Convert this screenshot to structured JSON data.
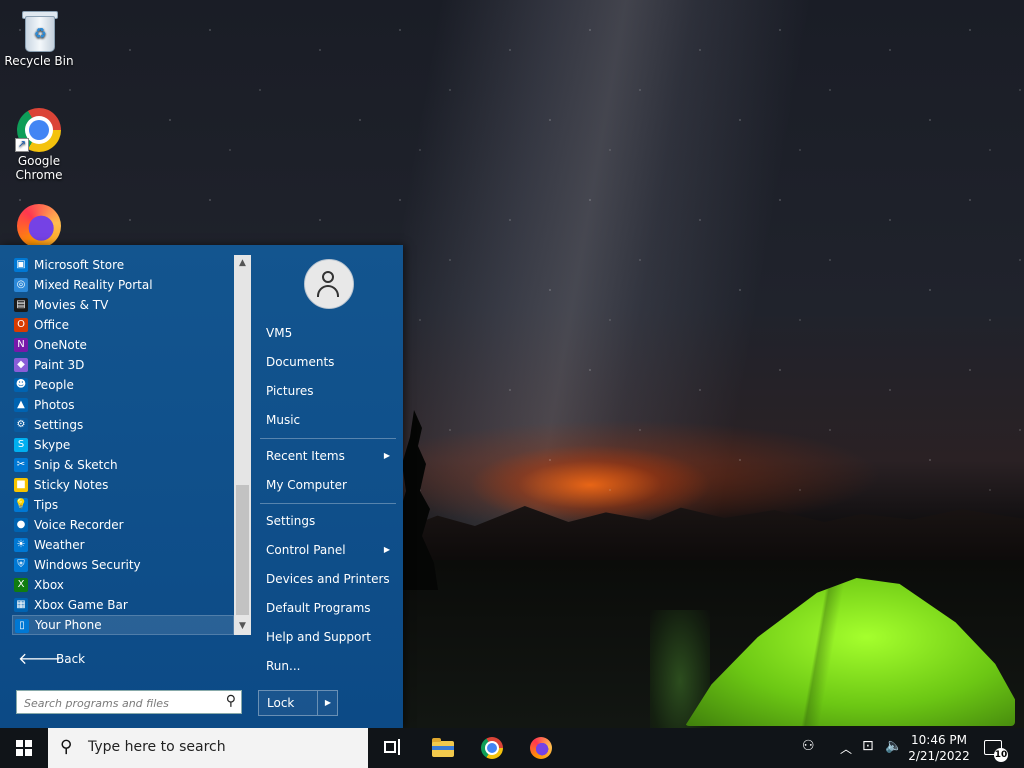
{
  "desktop": {
    "icons": [
      {
        "label": "Recycle Bin",
        "icon": "recycle-bin-icon"
      },
      {
        "label_line1": "Google",
        "label_line2": "Chrome",
        "icon": "chrome-icon"
      },
      {
        "label": "Firefox",
        "icon": "firefox-icon"
      }
    ]
  },
  "start_menu": {
    "programs": [
      {
        "label": "Microsoft Store",
        "icon": "store-icon",
        "color": "#0078d4",
        "glyph": "▣"
      },
      {
        "label": "Mixed Reality Portal",
        "icon": "mixed-reality-icon",
        "color": "#2b88d8",
        "glyph": "◎"
      },
      {
        "label": "Movies & TV",
        "icon": "movies-icon",
        "color": "#1a1a1a",
        "glyph": "▤"
      },
      {
        "label": "Office",
        "icon": "office-icon",
        "color": "#d83b01",
        "glyph": "O"
      },
      {
        "label": "OneNote",
        "icon": "onenote-icon",
        "color": "#7719aa",
        "glyph": "N"
      },
      {
        "label": "Paint 3D",
        "icon": "paint3d-icon",
        "color": "#8a5dd8",
        "glyph": "◆"
      },
      {
        "label": "People",
        "icon": "people-icon",
        "color": "#0063b1",
        "glyph": "☻"
      },
      {
        "label": "Photos",
        "icon": "photos-icon",
        "color": "#0063b1",
        "glyph": "▲"
      },
      {
        "label": "Settings",
        "icon": "settings-gear-icon",
        "color": "#0a5a9e",
        "glyph": "⚙"
      },
      {
        "label": "Skype",
        "icon": "skype-icon",
        "color": "#00aff0",
        "glyph": "S"
      },
      {
        "label": "Snip & Sketch",
        "icon": "snip-sketch-icon",
        "color": "#0078d4",
        "glyph": "✂"
      },
      {
        "label": "Sticky Notes",
        "icon": "sticky-notes-icon",
        "color": "#f7c300",
        "glyph": "■"
      },
      {
        "label": "Tips",
        "icon": "tips-icon",
        "color": "#0078d4",
        "glyph": "💡"
      },
      {
        "label": "Voice Recorder",
        "icon": "voice-recorder-icon",
        "color": "#0063b1",
        "glyph": "●"
      },
      {
        "label": "Weather",
        "icon": "weather-icon",
        "color": "#0078d4",
        "glyph": "☀"
      },
      {
        "label": "Windows Security",
        "icon": "shield-icon",
        "color": "#0078d4",
        "glyph": "⛨"
      },
      {
        "label": "Xbox",
        "icon": "xbox-icon",
        "color": "#107c10",
        "glyph": "X"
      },
      {
        "label": "Xbox Game Bar",
        "icon": "game-bar-icon",
        "color": "#0063b1",
        "glyph": "▦"
      },
      {
        "label": "Your Phone",
        "icon": "phone-icon",
        "color": "#0078d4",
        "glyph": "▯"
      }
    ],
    "back_label": "Back",
    "search_placeholder": "Search programs and files",
    "user_name": "VM5",
    "right_links": {
      "documents": "Documents",
      "pictures": "Pictures",
      "music": "Music",
      "recent_items": "Recent Items",
      "my_computer": "My Computer",
      "settings": "Settings",
      "control_panel": "Control Panel",
      "devices_printers": "Devices and Printers",
      "default_programs": "Default Programs",
      "help_support": "Help and Support",
      "run": "Run..."
    },
    "lock_label": "Lock"
  },
  "taskbar": {
    "search_text": "Type here to search",
    "time": "10:46 PM",
    "date": "2/21/2022",
    "notification_count": "10"
  },
  "colors": {
    "menu_blue": "#0c4a86",
    "taskbar": "#101418",
    "tent_green": "#8fe821"
  }
}
